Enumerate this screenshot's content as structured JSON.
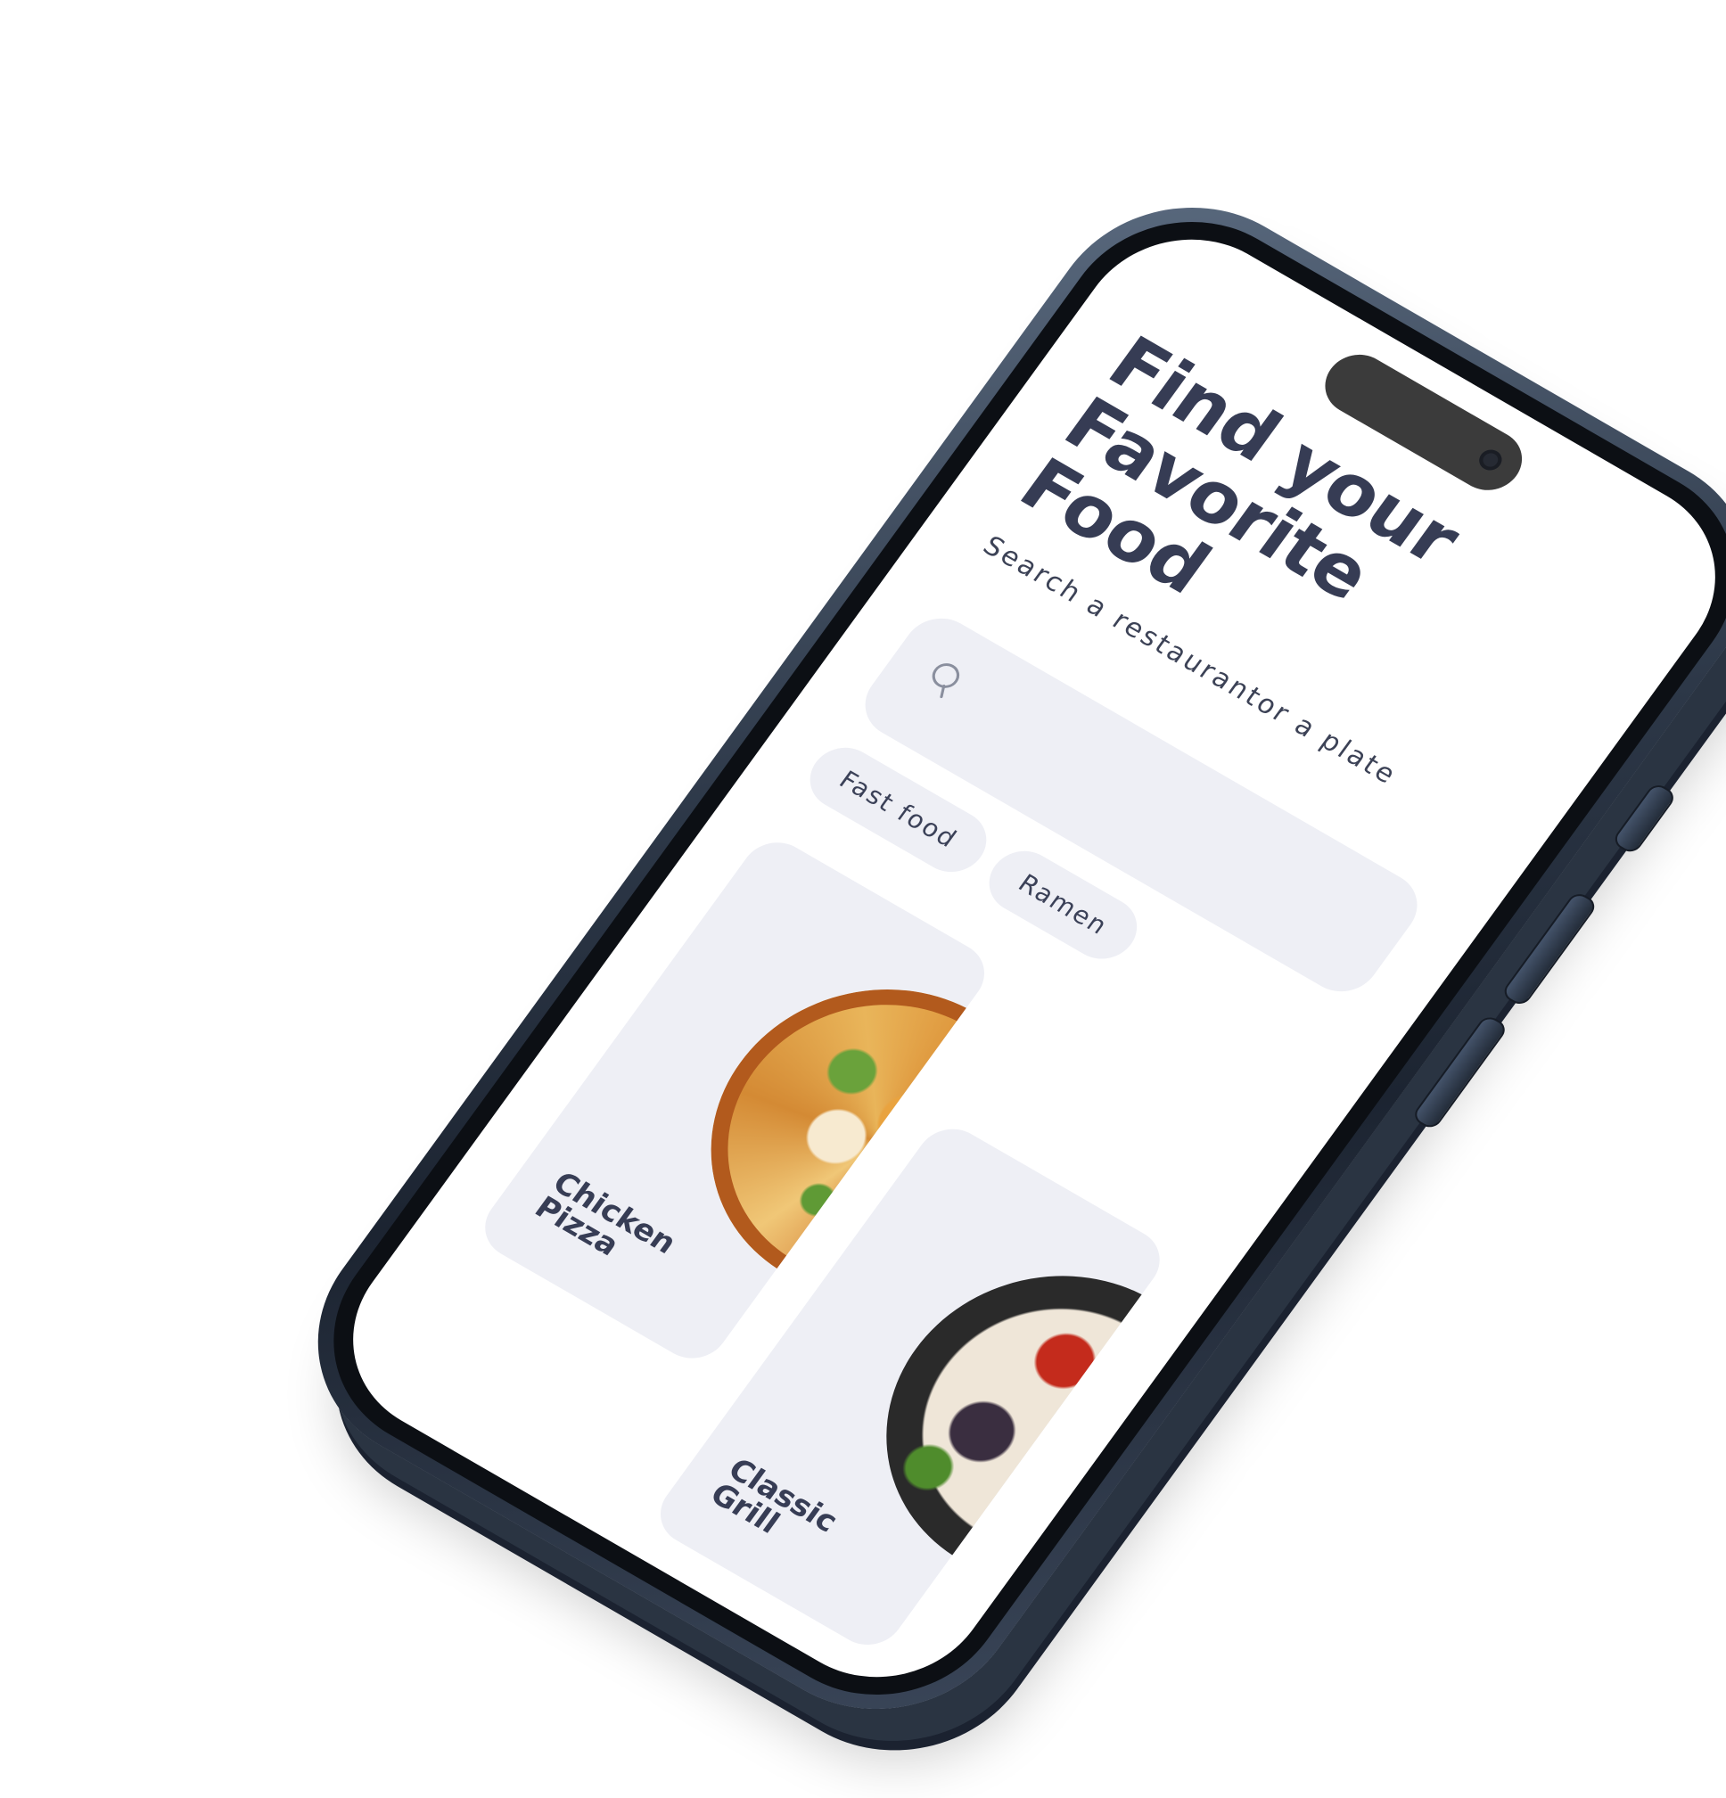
{
  "header": {
    "title_lines": [
      "Find your",
      "Favorite",
      "Food"
    ],
    "subtitle": "Search a restaurantor a plate"
  },
  "search": {
    "icon": "search-icon"
  },
  "filters": {
    "chips": [
      {
        "label": "Fast food"
      },
      {
        "label": "Ramen"
      }
    ]
  },
  "cards": [
    {
      "title_lines": [
        "Chicken",
        "Pizza"
      ],
      "image": "chicken-pizza-photo"
    },
    {
      "title_lines": [
        "Classic",
        "Grill"
      ],
      "image": "grilled-platter-photo"
    }
  ],
  "colors": {
    "text": "#363c54",
    "surface": "#eeeff5",
    "background": "#ffffff",
    "phone_frame": "#2d3848"
  }
}
